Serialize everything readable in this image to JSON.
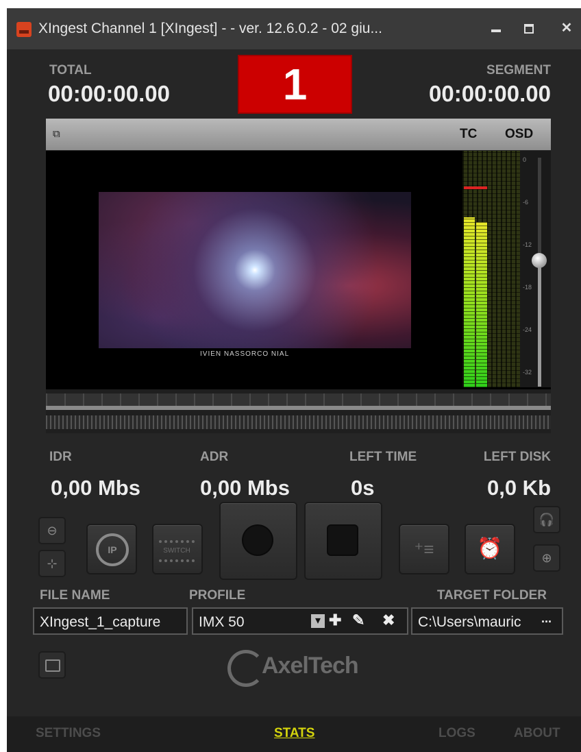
{
  "window": {
    "title": "XIngest Channel 1     [XIngest] -  - ver. 12.6.0.2 - 02 giu...",
    "close_glyph": "✕"
  },
  "header": {
    "total_label": "TOTAL",
    "total_value": "00:00:00.00",
    "channel_number": "1",
    "segment_label": "SEGMENT",
    "segment_value": "00:00:00.00",
    "channel_color": "#cc0000"
  },
  "video": {
    "pin_glyph": "⧉",
    "tc_label": "TC",
    "osd_label": "OSD",
    "caption": "IVIEN NASSORCO NIAL",
    "vu_scale": [
      "0",
      "-6",
      "-12",
      "-18",
      "-24",
      "-32"
    ],
    "vu_levels": {
      "left": 0.72,
      "right": 0.7
    },
    "volume_level": 0.55
  },
  "stats": {
    "idr_label": "IDR",
    "idr_value": "0,00 Mbs",
    "adr_label": "ADR",
    "adr_value": "0,00 Mbs",
    "left_time_label": "LEFT TIME",
    "left_time_value": "0s",
    "left_disk_label": "LEFT DISK",
    "left_disk_value": "0,0 Kb"
  },
  "controls": {
    "ip_label": "IP",
    "switch_label": "SWITCH",
    "input_glyph": "⊖",
    "crop_glyph": "⊹",
    "add_list_glyph": "⁺≡",
    "alarm_glyph": "⏰",
    "headphones_glyph": "🎧",
    "download_glyph": "⊕"
  },
  "fields": {
    "file_name_label": "FILE NAME",
    "file_name_value": "XIngest_1_capture",
    "profile_label": "PROFILE",
    "profile_value": "IMX 50",
    "add_glyph": "✚",
    "edit_glyph": "✎",
    "delete_glyph": "✖",
    "dropdown_glyph": "▾",
    "target_folder_label": "TARGET FOLDER",
    "target_folder_value": "C:\\Users\\mauric",
    "browse_glyph": "..."
  },
  "branding": {
    "logo_text": "AxelTech"
  },
  "tabs": [
    {
      "label": "SETTINGS"
    },
    {
      "label": "STATS"
    },
    {
      "label": "LOGS"
    },
    {
      "label": "ABOUT"
    }
  ],
  "active_tab": "STATS",
  "accent_color": "#d4d40c"
}
